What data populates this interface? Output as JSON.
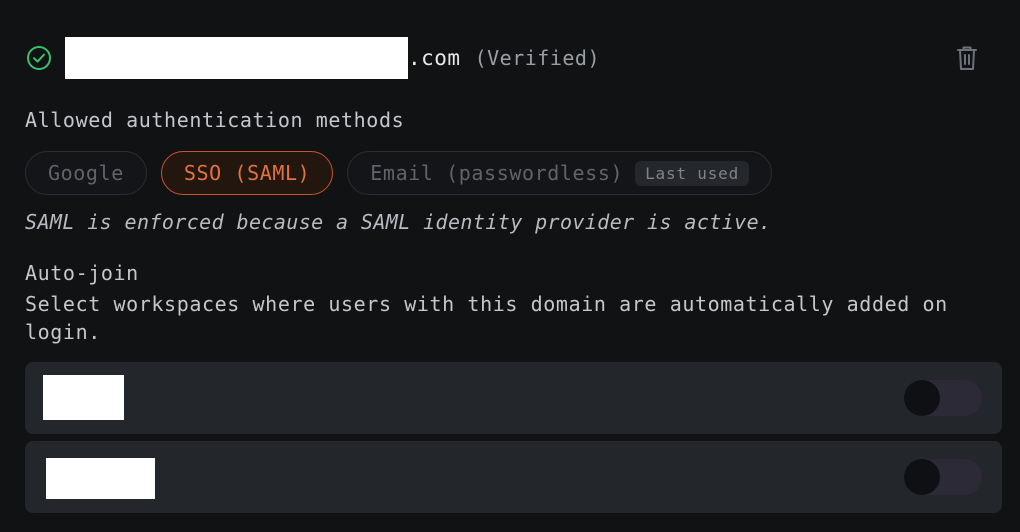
{
  "domain": {
    "suffix": ".com",
    "status": "(Verified)",
    "icons": {
      "verified": "check-circle-icon",
      "delete": "trash-icon"
    },
    "colors": {
      "verified": "#3bbf6a"
    }
  },
  "auth": {
    "label": "Allowed authentication methods",
    "methods": [
      {
        "label": "Google",
        "active": false
      },
      {
        "label": "SSO (SAML)",
        "active": true
      },
      {
        "label": "Email (passwordless)",
        "active": false,
        "badge": "Last used"
      }
    ],
    "note": "SAML is enforced because a SAML identity provider is active.",
    "colors": {
      "active": "#e2733f"
    }
  },
  "autojoin": {
    "title": "Auto-join",
    "description": "Select workspaces where users with this domain are automatically added on login.",
    "workspaces": [
      {
        "toggle_on": false
      },
      {
        "toggle_on": false
      }
    ]
  }
}
